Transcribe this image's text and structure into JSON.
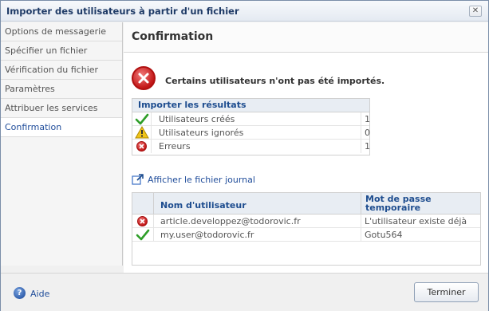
{
  "window": {
    "title": "Importer des utilisateurs à partir d'un fichier"
  },
  "sidebar": {
    "items": [
      {
        "label": "Options de messagerie"
      },
      {
        "label": "Spécifier un fichier"
      },
      {
        "label": "Vérification du fichier"
      },
      {
        "label": "Paramètres"
      },
      {
        "label": "Attribuer les services"
      },
      {
        "label": "Confirmation",
        "active": true
      }
    ]
  },
  "main": {
    "title": "Confirmation",
    "alert": "Certains utilisateurs n'ont pas été importés.",
    "results": {
      "header": "Importer les résultats",
      "rows": [
        {
          "icon": "check-icon",
          "label": "Utilisateurs créés",
          "value": "1"
        },
        {
          "icon": "warning-icon",
          "label": "Utilisateurs ignorés",
          "value": "0"
        },
        {
          "icon": "error-icon",
          "label": "Erreurs",
          "value": "1"
        }
      ]
    },
    "log_link": "Afficher le fichier journal",
    "users": {
      "columns": [
        "Nom d'utilisateur",
        "Mot de passe temporaire"
      ],
      "rows": [
        {
          "icon": "error-icon",
          "username": "article.developpez@todorovic.fr",
          "password": "L'utilisateur existe déjà"
        },
        {
          "icon": "check-icon",
          "username": "my.user@todorovic.fr",
          "password": "Gotu564"
        }
      ]
    }
  },
  "footer": {
    "help": "Aide",
    "finish": "Terminer"
  },
  "colors": {
    "accent": "#1e4d8f",
    "error": "#c21717",
    "success": "#2e9e28",
    "warning": "#f0c419"
  }
}
